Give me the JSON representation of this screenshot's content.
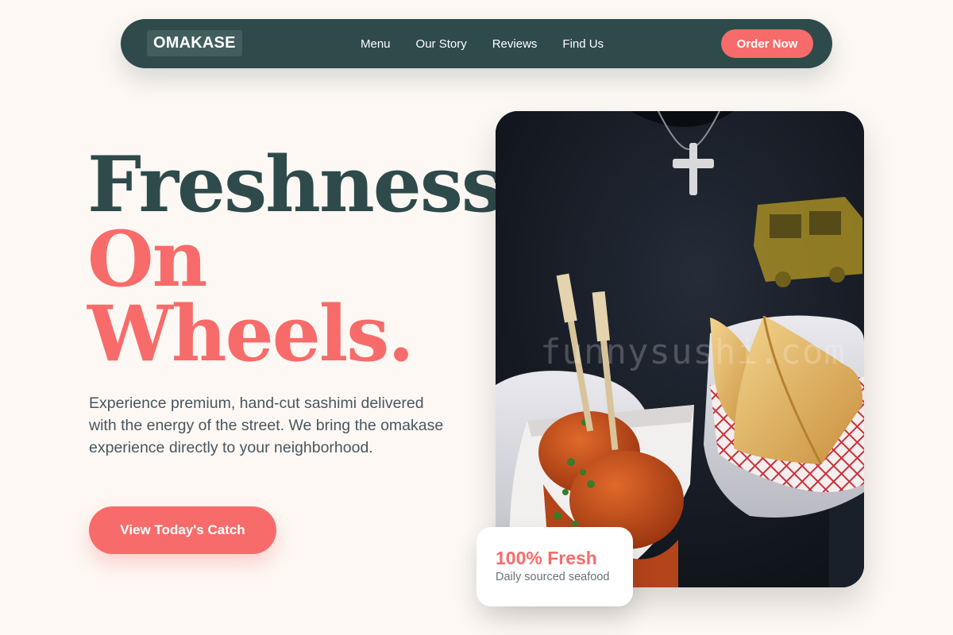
{
  "nav": {
    "logo": "OMAKASE",
    "links": [
      "Menu",
      "Our Story",
      "Reviews",
      "Find Us"
    ],
    "cta": "Order Now"
  },
  "hero": {
    "line1": "Freshness",
    "line2": "On",
    "line3": "Wheels.",
    "description": "Experience premium, hand-cut sashimi delivered with the energy of the street. We bring the omakase experience directly to your neighborhood.",
    "cta": "View Today's Catch"
  },
  "photo": {
    "watermark": "funnysushi.com"
  },
  "badge": {
    "title": "100% Fresh",
    "subtitle": "Daily sourced seafood"
  },
  "colors": {
    "primary": "#2f4a4b",
    "accent": "#f76c6a",
    "background": "#fdf8f3"
  }
}
